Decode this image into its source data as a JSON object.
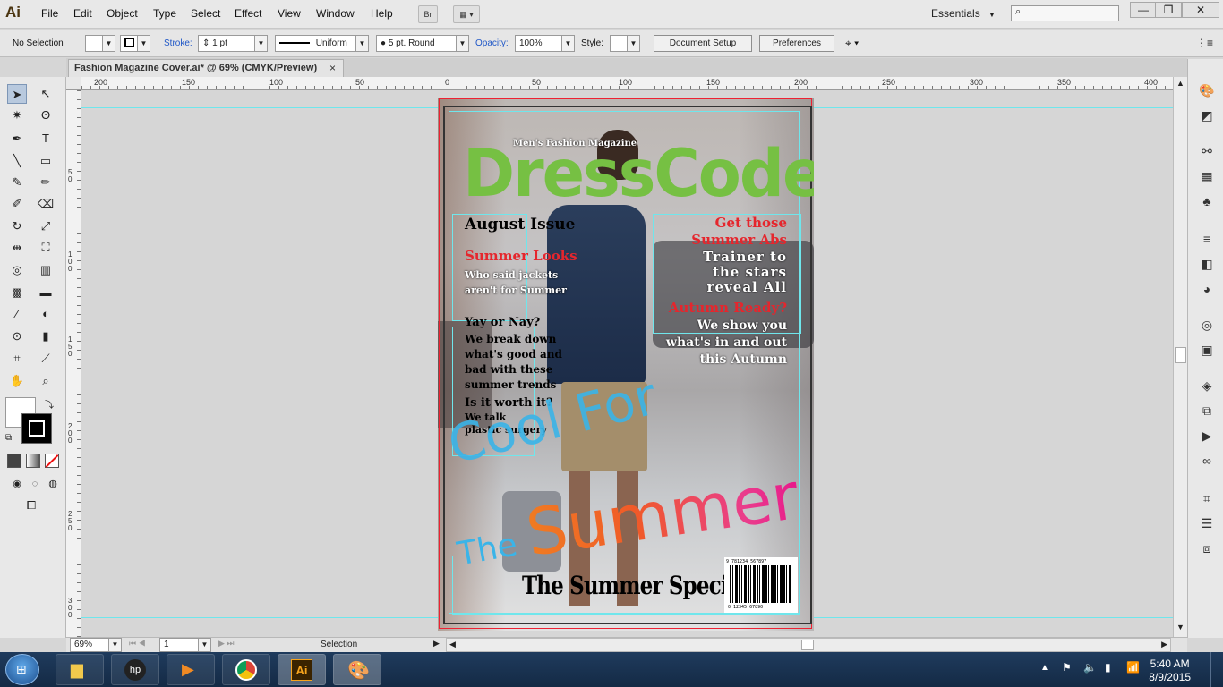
{
  "app": {
    "logo": "Ai"
  },
  "menu": [
    "File",
    "Edit",
    "Object",
    "Type",
    "Select",
    "Effect",
    "View",
    "Window",
    "Help"
  ],
  "bridge_label": "Br",
  "workspace": {
    "label": "Essentials"
  },
  "window_controls": {
    "minimize": "—",
    "restore": "❐",
    "close": "✕"
  },
  "control_bar": {
    "selection": "No Selection",
    "stroke_label": "Stroke:",
    "stroke_weight": "1 pt",
    "profile": "Uniform",
    "brush": "5 pt. Round",
    "opacity_label": "Opacity:",
    "opacity_value": "100%",
    "style_label": "Style:",
    "document_setup": "Document Setup",
    "preferences": "Preferences"
  },
  "document": {
    "tab_title": "Fashion Magazine Cover.ai* @ 69% (CMYK/Preview)",
    "close": "×"
  },
  "rulers": {
    "top": [
      "200",
      "150",
      "100",
      "50",
      "0",
      "50",
      "100",
      "150",
      "200",
      "250",
      "300",
      "350",
      "400"
    ],
    "left": [
      "5\n0",
      "1\n0\n0",
      "1\n5\n0",
      "2\n0\n0",
      "2\n5\n0",
      "3\n0\n0"
    ]
  },
  "artwork": {
    "tagline": "Men's Fashion Magazine",
    "masthead": "DressCode",
    "issue": "August Issue",
    "summer_looks": "Summer Looks",
    "jackets_line1": "Who said jackets",
    "jackets_line2": "aren't for Summer",
    "yay_or_nay": "Yay or Nay?",
    "break_down": [
      "We break down",
      "what's good and",
      "bad with these",
      "summer trends"
    ],
    "worth_it": "Is it worth it?",
    "talk": [
      "We talk",
      "plastic surgery"
    ],
    "abs_red": [
      "Get those",
      "Summer Abs"
    ],
    "trainer": [
      "Trainer to",
      "the stars",
      "reveal All"
    ],
    "autumn_ready": "Autumn Ready?",
    "show_you": [
      "We show you",
      "what's in and out",
      "this Autumn"
    ],
    "cool_for": "Cool For",
    "the": "The",
    "summer_script": "Summer",
    "special": "The Summer Special",
    "barcode_top": "9 781234 567897",
    "barcode_bottom": "0  12345  67890"
  },
  "status": {
    "zoom": "69%",
    "page": "1",
    "tool": "Selection"
  },
  "taskbar": {
    "time": "5:40 AM",
    "date": "8/9/2015"
  },
  "colors": {
    "masthead_green": "#76c043",
    "headline_red": "#e5262d",
    "script_blue": "#3ab4e8",
    "script_orange": "#f07c22"
  }
}
